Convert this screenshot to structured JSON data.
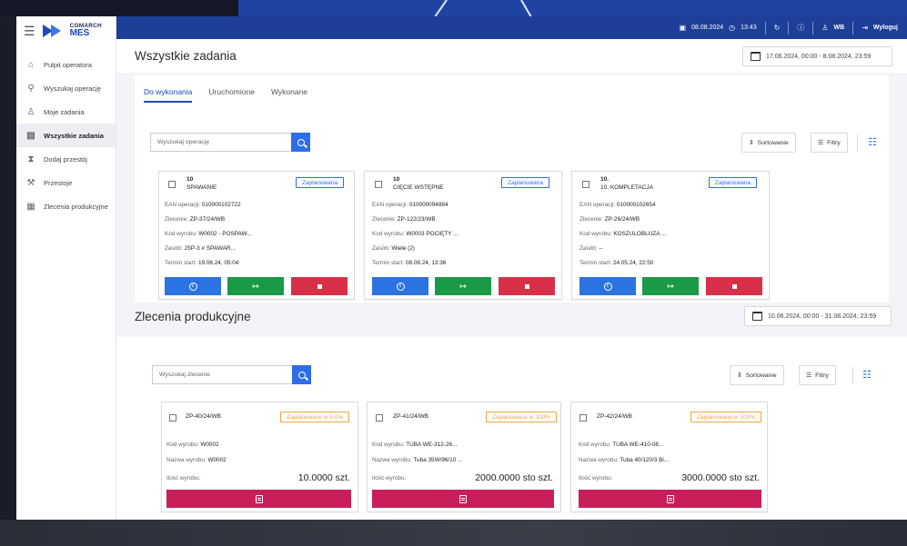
{
  "topbar": {
    "date": "08.08.2024",
    "time": "13:43",
    "user": "WB",
    "logout_label": "Wyloguj"
  },
  "logo": {
    "line1": "COMARCH",
    "line2": "MES"
  },
  "sidebar": {
    "items": [
      {
        "label": "Pulpit operatora",
        "icon": "home-icon"
      },
      {
        "label": "Wyszukaj operację",
        "icon": "search-icon"
      },
      {
        "label": "Moje zadania",
        "icon": "user-icon"
      },
      {
        "label": "Wszystkie zadania",
        "icon": "tasks-icon",
        "active": true
      },
      {
        "label": "Dodaj przestój",
        "icon": "hourglass-icon"
      },
      {
        "label": "Przestoje",
        "icon": "wrench-icon"
      },
      {
        "label": "Zlecenia produkcyjne",
        "icon": "clipboard-icon"
      }
    ]
  },
  "tasks": {
    "title": "Wszystkie zadania",
    "date_range": "17.06.2024, 00:00 - 8.08.2024, 23:59",
    "tabs": [
      "Do wykonania",
      "Uruchomione",
      "Wykonane"
    ],
    "search_placeholder": "Wyszukaj operację",
    "sort_label": "Sortowanie",
    "filter_label": "Filtry",
    "cards": [
      {
        "number": "10",
        "name": "SPAWANIE",
        "status": "Zaplanowana",
        "ean_label": "EAN operacji:",
        "ean": "010000102722",
        "order_label": "Zlecenie:",
        "order": "ZP-37/24/WB",
        "product_label": "Kod wyrobu:",
        "product": "W0002 - POSPAW...",
        "resource_label": "Zasób:",
        "resource": "JSP-3 # SPAWAR...",
        "start_label": "Termin start:",
        "start": "19.06.24, 05:04"
      },
      {
        "number": "10",
        "name": "CIĘCIE WSTĘPNE",
        "status": "Zaplanowana",
        "ean_label": "EAN operacji:",
        "ean": "010000094884",
        "order_label": "Zlecenie:",
        "order": "ZP-122/23/WB",
        "product_label": "Kod wyrobu:",
        "product": "W0003 POCIĘTY ...",
        "resource_label": "Zasób:",
        "resource": "Wiele (2)",
        "start_label": "Termin start:",
        "start": "08.08.24, 13:36"
      },
      {
        "number": "10.",
        "name": "10. KOMPLETACJA",
        "status": "Zaplanowana",
        "ean_label": "EAN operacji:",
        "ean": "010000102654",
        "order_label": "Zlecenie:",
        "order": "ZP-26/24/WB",
        "product_label": "Kod wyrobu:",
        "product": "KOSZULOBLUZA ...",
        "resource_label": "Zasób:",
        "resource": "--",
        "start_label": "Termin start:",
        "start": "24.05.24, 22:50"
      }
    ]
  },
  "orders": {
    "title": "Zlecenia produkcyjne",
    "date_range": "10.06.2024, 00:00 - 31.08.2024, 23:59",
    "search_placeholder": "Wyszukaj zlecenie",
    "sort_label": "Sortowanie",
    "filter_label": "Filtry",
    "cards": [
      {
        "number": "ZP-40/24/WB",
        "status": "Zaplanowane w 0.0%",
        "code_label": "Kod wyrobu:",
        "code": "W0002",
        "name_label": "Nazwa wyrobu:",
        "name": "W0002",
        "qty_label": "Ilość wyrobu:",
        "qty": "10.0000 szt."
      },
      {
        "number": "ZP-41/24/WB",
        "status": "Zaplanowane w 100%",
        "code_label": "Kod wyrobu:",
        "code": "TUBA WE-312-26...",
        "name_label": "Nazwa wyrobu:",
        "name": "Tuba 35W/96/10 ...",
        "qty_label": "Ilość wyrobu:",
        "qty": "2000.0000 sto szt."
      },
      {
        "number": "ZP-42/24/WB",
        "status": "Zaplanowane w 100%",
        "code_label": "Kod wyrobu:",
        "code": "TUBA WE-410-08...",
        "name_label": "Nazwa wyrobu:",
        "name": "Tuba 40/120/3 Bi...",
        "qty_label": "Ilość wyrobu:",
        "qty": "3000.0000 sto szt."
      }
    ]
  },
  "colors": {
    "topbar": "#1e3f98",
    "accent": "#2d6ee8",
    "start": "#1a9a45",
    "stop": "#d9304a",
    "detail": "#c91e5a",
    "badge_orange": "#f0a443"
  }
}
